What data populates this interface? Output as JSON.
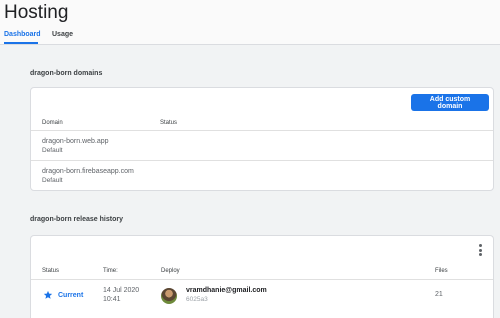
{
  "header": {
    "title": "Hosting",
    "tabs": [
      {
        "label": "Dashboard",
        "active": true
      },
      {
        "label": "Usage",
        "active": false
      }
    ]
  },
  "domains": {
    "title": "dragon-born domains",
    "add_button": "Add custom domain",
    "columns": [
      "Domain",
      "Status"
    ],
    "rows": [
      {
        "domain": "dragon-born.web.app",
        "sub": "Default",
        "status": ""
      },
      {
        "domain": "dragon-born.firebaseapp.com",
        "sub": "Default",
        "status": ""
      }
    ]
  },
  "release": {
    "title": "dragon-born release history",
    "columns": [
      "Status",
      "Time:",
      "Deploy",
      "Files"
    ],
    "rows": [
      {
        "status": "Current",
        "date": "14 Jul 2020",
        "time": "10:41",
        "deployer": "vramdhanie@gmail.com",
        "hash": "6025a3",
        "files": "21"
      }
    ]
  },
  "colors": {
    "accent": "#1a73e8",
    "background": "#f1f3f4",
    "card": "#ffffff"
  },
  "icons": {
    "status": "star-icon",
    "menu": "more-vert-icon"
  }
}
